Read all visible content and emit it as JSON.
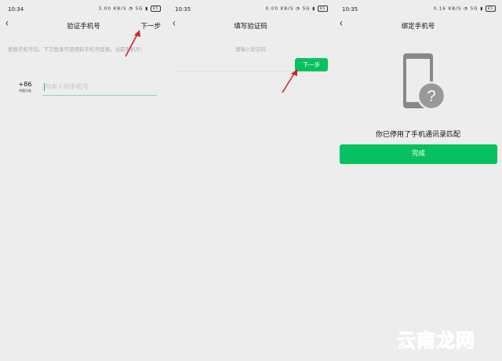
{
  "screens": [
    {
      "status": {
        "time": "10:34",
        "speed": "3.00 KB/S",
        "signal": "5G",
        "battery": "85"
      },
      "nav": {
        "back": "‹",
        "title": "验证手机号",
        "next": "下一步"
      },
      "hint": "更换手机号后，下次登录可使用新手机号登录。当前手机号：",
      "country_code": "+86",
      "country_name": "中国大陆",
      "phone_placeholder": "你本人的手机号"
    },
    {
      "status": {
        "time": "10:35",
        "speed": "0.00 KB/S",
        "signal": "5G",
        "battery": "85"
      },
      "nav": {
        "back": "‹",
        "title": "填写验证码"
      },
      "code_placeholder": "请输入验证码",
      "next_button": "下一步"
    },
    {
      "status": {
        "time": "10:35",
        "speed": "0.16 KB/S",
        "signal": "5G",
        "battery": "85"
      },
      "nav": {
        "back": "‹",
        "title": "绑定手机号"
      },
      "message": "你已停用了手机通讯录匹配",
      "done_button": "完成"
    }
  ],
  "watermark": "云南龙网",
  "colors": {
    "accent": "#07c160",
    "arrow": "#d0281e",
    "background": "#ededed"
  }
}
